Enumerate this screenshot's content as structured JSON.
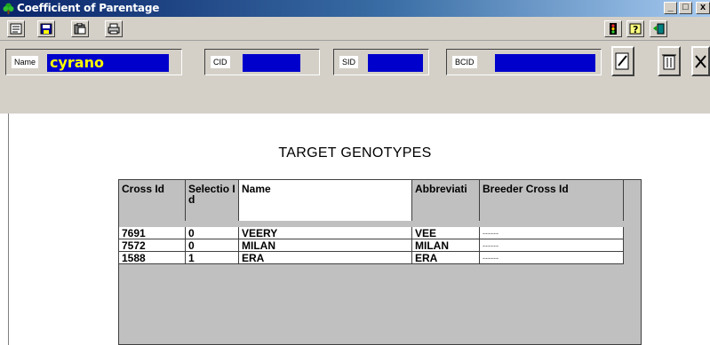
{
  "window": {
    "title": "Coefficient of Parentage",
    "buttons": {
      "minimize": "_",
      "maximize": "□",
      "close": "x"
    }
  },
  "toolbar": {
    "left_icons": [
      "list-icon",
      "save-icon",
      "clipboard-icon",
      "print-icon"
    ],
    "right_icons": [
      "traffic-light-icon",
      "help-icon",
      "exit-icon"
    ]
  },
  "fields": {
    "name": {
      "label": "Name",
      "value": "cyrano"
    },
    "cid": {
      "label": "CID",
      "value": ""
    },
    "sid": {
      "label": "SID",
      "value": ""
    },
    "bcid": {
      "label": "BCID",
      "value": ""
    }
  },
  "actions": [
    "edit-icon",
    "trash-icon",
    "close-icon"
  ],
  "heading": "TARGET GENOTYPES",
  "table": {
    "columns": [
      "Cross Id",
      "Selectio Id",
      "Name",
      "Abbreviati",
      "Breeder Cross Id"
    ],
    "rows": [
      [
        "7691",
        "0",
        "VEERY",
        "VEE",
        "------"
      ],
      [
        "7572",
        "0",
        "MILAN",
        "MILAN",
        "------"
      ],
      [
        "1588",
        "1",
        "ERA",
        "ERA",
        "------"
      ]
    ]
  },
  "colors": {
    "field_fill": "#0000cc",
    "field_text": "#ffff00",
    "chrome": "#d4d0c8"
  }
}
